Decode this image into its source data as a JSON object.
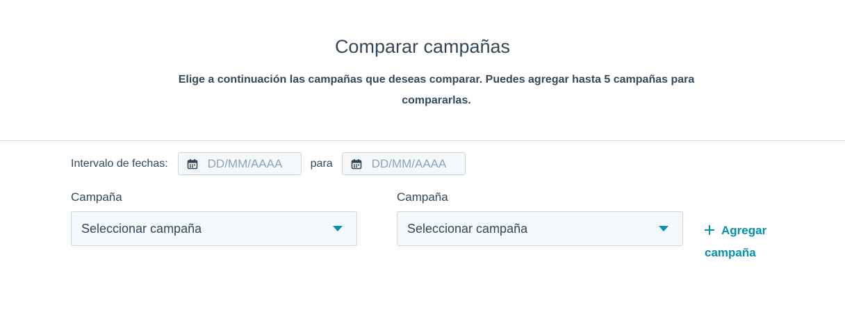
{
  "header": {
    "title": "Comparar campañas",
    "subtitle": "Elige a continuación las campañas que deseas comparar. Puedes agregar hasta 5 campañas para compararlas."
  },
  "date_range": {
    "label": "Intervalo de fechas:",
    "separator": "para",
    "start_placeholder": "DD/MM/AAAA",
    "end_placeholder": "DD/MM/AAAA",
    "icon": "calendar-icon"
  },
  "campaigns": [
    {
      "label": "Campaña",
      "selected": "Seleccionar campaña"
    },
    {
      "label": "Campaña",
      "selected": "Seleccionar campaña"
    }
  ],
  "add_campaign": {
    "label": "Agregar campaña",
    "icon": "plus-icon"
  },
  "colors": {
    "text": "#33475b",
    "accent": "#0091ae",
    "input_bg": "#f5f8fa",
    "border": "#cbd6e2",
    "placeholder": "#8fa3b9"
  }
}
